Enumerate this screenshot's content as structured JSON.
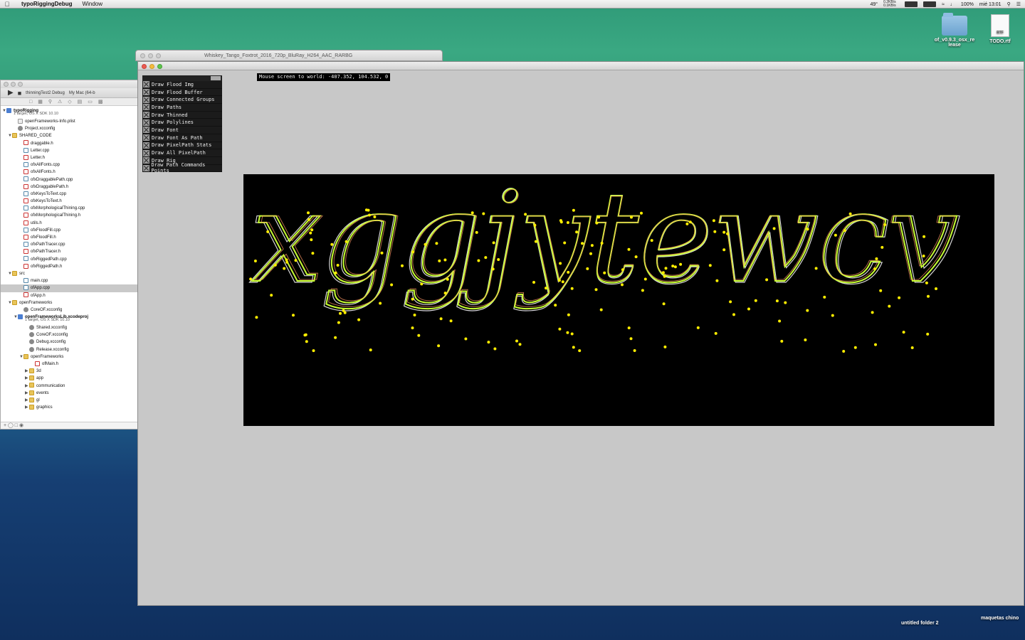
{
  "menubar": {
    "app_name": "typoRiggingDebug",
    "menu_window": "Window",
    "temp": "49°",
    "net": "0.2KB/s 0.1KB/s",
    "battery": "100%",
    "clock": "mié 13:01"
  },
  "desktop": {
    "icon_folder_label": "of_v0.9.3_osx_re lease",
    "icon_doc_label": "TODO.rtf",
    "icon_doc_badge": "RTF",
    "bottom_folder_label": "untitled folder 2",
    "bottom_right_label": "maquetas chino"
  },
  "video_window": {
    "title": "Whiskey_Tango_Foxtrot_2016_720p_BluRay_H264_AAC_RARBG"
  },
  "xcode": {
    "scheme": "thinningTest2 Debug",
    "destination": "My Mac (64-b",
    "tree": [
      {
        "label": "typoRigging",
        "sub": "1 target, OS X SDK 10.10",
        "icon": "proj",
        "indent": 0,
        "tri": "▼",
        "bold": true
      },
      {
        "label": "openFrameworks-Info.plist",
        "icon": "plist",
        "indent": 2
      },
      {
        "label": "Project.xcconfig",
        "icon": "cfg",
        "indent": 2
      },
      {
        "label": "SHARED_CODE",
        "icon": "fold",
        "indent": 1,
        "tri": "▼"
      },
      {
        "label": "draggable.h",
        "icon": "h",
        "indent": 3
      },
      {
        "label": "Letter.cpp",
        "icon": "cpp",
        "indent": 3
      },
      {
        "label": "Letter.h",
        "icon": "h",
        "indent": 3
      },
      {
        "label": "ofxAllFonts.cpp",
        "icon": "cpp",
        "indent": 3
      },
      {
        "label": "ofxAllFonts.h",
        "icon": "h",
        "indent": 3
      },
      {
        "label": "ofxDraggablePath.cpp",
        "icon": "cpp",
        "indent": 3
      },
      {
        "label": "ofxDraggablePath.h",
        "icon": "h",
        "indent": 3
      },
      {
        "label": "ofxKeysToText.cpp",
        "icon": "cpp",
        "indent": 3
      },
      {
        "label": "ofxKeysToText.h",
        "icon": "h",
        "indent": 3
      },
      {
        "label": "ofxMorphologicalThining.cpp",
        "icon": "cpp",
        "indent": 3
      },
      {
        "label": "ofxMorphologicalThining.h",
        "icon": "h",
        "indent": 3
      },
      {
        "label": "utils.h",
        "icon": "h",
        "indent": 3
      },
      {
        "label": "ofxFloodFill.cpp",
        "icon": "cpp",
        "indent": 3
      },
      {
        "label": "ofxFloodFill.h",
        "icon": "h",
        "indent": 3
      },
      {
        "label": "ofxPathTracer.cpp",
        "icon": "cpp",
        "indent": 3
      },
      {
        "label": "ofxPathTracer.h",
        "icon": "h",
        "indent": 3
      },
      {
        "label": "ofxRiggedPath.cpp",
        "icon": "cpp",
        "indent": 3
      },
      {
        "label": "ofxRiggedPath.h",
        "icon": "h",
        "indent": 3
      },
      {
        "label": "src",
        "icon": "fold",
        "indent": 1,
        "tri": "▼"
      },
      {
        "label": "main.cpp",
        "icon": "cpp",
        "indent": 3
      },
      {
        "label": "ofApp.cpp",
        "icon": "cpp",
        "indent": 3,
        "selected": true
      },
      {
        "label": "ofApp.h",
        "icon": "h",
        "indent": 3
      },
      {
        "label": "openFrameworks",
        "icon": "fold",
        "indent": 1,
        "tri": "▼"
      },
      {
        "label": "CoreOF.xcconfig",
        "icon": "cfg",
        "indent": 3
      },
      {
        "label": "openFrameworksLib.xcodeproj",
        "sub": "1 target, OS X SDK 10.10",
        "icon": "proj",
        "indent": 2,
        "tri": "▼",
        "bold": true
      },
      {
        "label": "Shared.xcconfig",
        "icon": "cfg",
        "indent": 4
      },
      {
        "label": "CoreOF.xcconfig",
        "icon": "cfg",
        "indent": 4
      },
      {
        "label": "Debug.xcconfig",
        "icon": "cfg",
        "indent": 4
      },
      {
        "label": "Release.xcconfig",
        "icon": "cfg",
        "indent": 4
      },
      {
        "label": "openFrameworks",
        "icon": "fold",
        "indent": 3,
        "tri": "▼"
      },
      {
        "label": "ofMain.h",
        "icon": "h",
        "indent": 5
      },
      {
        "label": "3d",
        "icon": "fold",
        "indent": 4,
        "tri": "▶"
      },
      {
        "label": "app",
        "icon": "fold",
        "indent": 4,
        "tri": "▶"
      },
      {
        "label": "communication",
        "icon": "fold",
        "indent": 4,
        "tri": "▶"
      },
      {
        "label": "events",
        "icon": "fold",
        "indent": 4,
        "tri": "▶"
      },
      {
        "label": "gl",
        "icon": "fold",
        "indent": 4,
        "tri": "▶"
      },
      {
        "label": "graphics",
        "icon": "fold",
        "indent": 4,
        "tri": "▶"
      }
    ]
  },
  "app": {
    "mouse_readout": "Mouse screen to world: -407.352, 104.532, 0",
    "toggles": [
      "Draw Flood Img",
      "Draw Flood Buffer",
      "Draw Connected Groups",
      "Draw Paths",
      "Draw Thinned",
      "Draw Polylines",
      "Draw Font",
      "Draw Font As Path",
      "Draw PixelPath Stats",
      "Draw All PixelPath",
      "Draw Rig",
      "Draw Path Commands Points"
    ],
    "canvas_text": "xggjytewcv",
    "colors": {
      "canvas": "#000000",
      "points": "#ffee00",
      "outline": "#d8d8d8",
      "path_a": "#c8ff33",
      "path_b": "#ff9966"
    }
  }
}
